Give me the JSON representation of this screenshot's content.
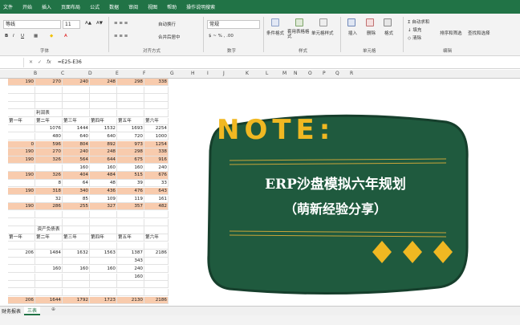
{
  "menu": [
    "文件",
    "开始",
    "插入",
    "页面布局",
    "公式",
    "数据",
    "审阅",
    "视图",
    "帮助",
    "操作说明搜索"
  ],
  "ribbon": {
    "font_name": "等线",
    "font_size": "11",
    "wrap_text": "自动换行",
    "merge_center": "合并后居中",
    "number_format": "常规",
    "cond_format": "条件格式",
    "table_format": "套用表格格式",
    "cell_style": "单元格样式",
    "insert": "插入",
    "delete": "删除",
    "format": "格式",
    "autosum": "自动求和",
    "fill": "填充",
    "clear": "清除",
    "sort_filter": "排序和筛选",
    "find_select": "查找和选择",
    "groups": [
      "字体",
      "对齐方式",
      "数字",
      "样式",
      "单元格",
      "编辑"
    ]
  },
  "formula_bar": {
    "fx": "fx",
    "formula": "=E25-E36"
  },
  "columns": [
    "B",
    "C",
    "D",
    "E",
    "F",
    "G",
    "H",
    "I",
    "J",
    "K",
    "L",
    "M",
    "N",
    "O",
    "P",
    "Q",
    "R"
  ],
  "rows": [
    {
      "hl": true,
      "cells": [
        "190",
        "270",
        "240",
        "248",
        "298",
        "338"
      ]
    },
    {
      "hl": false,
      "cells": [
        "",
        "",
        "",
        "",
        "",
        ""
      ]
    },
    {
      "hl": false,
      "cells": [
        "",
        "",
        "",
        "",
        "",
        ""
      ]
    },
    {
      "hl": false,
      "cells": [
        "",
        "",
        "",
        "",
        "",
        ""
      ]
    },
    {
      "hl": false,
      "cells": [
        "",
        "利润表",
        "",
        "",
        "",
        ""
      ]
    },
    {
      "hl": false,
      "cells": [
        "第一年",
        "第二年",
        "第三年",
        "第四年",
        "第五年",
        "第六年"
      ]
    },
    {
      "hl": false,
      "cells": [
        "",
        "1076",
        "1444",
        "1532",
        "1693",
        "2254"
      ]
    },
    {
      "hl": false,
      "cells": [
        "",
        "480",
        "640",
        "640",
        "720",
        "1000"
      ]
    },
    {
      "hl": true,
      "cells": [
        "0",
        "596",
        "804",
        "892",
        "973",
        "1254"
      ]
    },
    {
      "hl": true,
      "cells": [
        "190",
        "270",
        "240",
        "248",
        "298",
        "338"
      ]
    },
    {
      "hl": true,
      "cells": [
        "190",
        "326",
        "564",
        "644",
        "675",
        "916"
      ]
    },
    {
      "hl": false,
      "cells": [
        "",
        "",
        "160",
        "160",
        "160",
        "240"
      ]
    },
    {
      "hl": true,
      "cells": [
        "190",
        "326",
        "404",
        "484",
        "515",
        "676"
      ]
    },
    {
      "hl": false,
      "cells": [
        "",
        "8",
        "64",
        "48",
        "39",
        "33"
      ]
    },
    {
      "hl": true,
      "cells": [
        "190",
        "318",
        "340",
        "436",
        "476",
        "643"
      ]
    },
    {
      "hl": false,
      "cells": [
        "",
        "32",
        "85",
        "109",
        "119",
        "161"
      ]
    },
    {
      "hl": true,
      "cells": [
        "190",
        "286",
        "255",
        "327",
        "357",
        "482"
      ]
    },
    {
      "hl": false,
      "cells": [
        "",
        "",
        "",
        "",
        "",
        ""
      ]
    },
    {
      "hl": false,
      "cells": [
        "",
        "",
        "",
        "",
        "",
        ""
      ]
    },
    {
      "hl": false,
      "cells": [
        "",
        "资产负债表",
        "",
        "",
        "",
        ""
      ]
    },
    {
      "hl": false,
      "cells": [
        "第一年",
        "第二年",
        "第三年",
        "第四年",
        "第五年",
        "第六年"
      ]
    },
    {
      "hl": false,
      "cells": [
        "",
        "",
        "",
        "",
        "",
        ""
      ]
    },
    {
      "hl": false,
      "cells": [
        "206",
        "1484",
        "1632",
        "1563",
        "1387",
        "2186"
      ]
    },
    {
      "hl": false,
      "cells": [
        "",
        "",
        "",
        "",
        "343",
        ""
      ]
    },
    {
      "hl": false,
      "cells": [
        "",
        "160",
        "160",
        "160",
        "240",
        ""
      ]
    },
    {
      "hl": false,
      "cells": [
        "",
        "",
        "",
        "",
        "160",
        ""
      ]
    },
    {
      "hl": false,
      "cells": [
        "",
        "",
        "",
        "",
        "",
        ""
      ]
    },
    {
      "hl": false,
      "cells": [
        "",
        "",
        "",
        "",
        "",
        ""
      ]
    },
    {
      "hl": true,
      "cells": [
        "206",
        "1644",
        "1792",
        "1723",
        "2130",
        "2186"
      ]
    }
  ],
  "sheet_tabs": [
    "财务报表",
    "三表"
  ],
  "overlay": {
    "note": "NOTE:",
    "title": "ERP沙盘模拟六年规划",
    "subtitle": "（萌新经验分享）",
    "card_color": "#1f5a3e",
    "accent_color": "#f0b822"
  }
}
